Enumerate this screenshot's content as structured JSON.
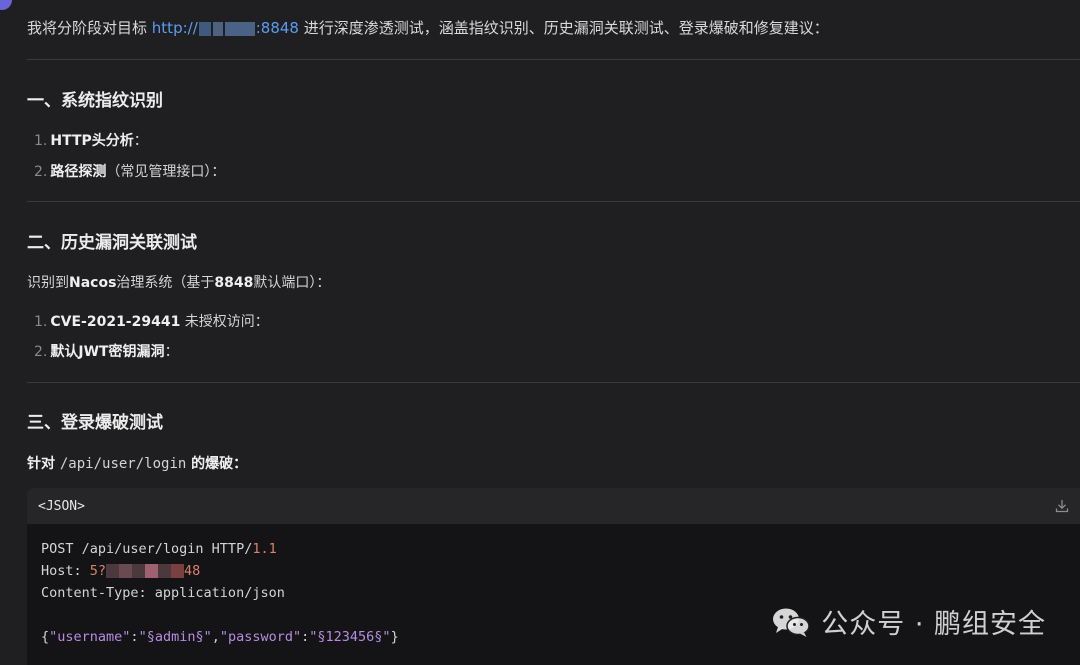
{
  "intro": {
    "prefix": "我将分阶段对目标",
    "link_start": "http://",
    "link_end": ":8848",
    "suffix": "进行深度渗透测试，涵盖指纹识别、历史漏洞关联测试、登录爆破和修复建议："
  },
  "section1": {
    "title": "一、系统指纹识别",
    "items": [
      {
        "num": "1.",
        "label": "HTTP头分析",
        "suffix": "："
      },
      {
        "num": "2.",
        "label": "路径探测",
        "suffix": "（常见管理接口）："
      }
    ]
  },
  "section2": {
    "title": "二、历史漏洞关联测试",
    "para_prefix": "识别到",
    "para_bold": "Nacos",
    "para_mid": "治理系统（基于",
    "para_bold2": "8848",
    "para_suffix": "默认端口）：",
    "items": [
      {
        "num": "1.",
        "label": "CVE-2021-29441",
        "suffix": " 未授权访问："
      },
      {
        "num": "2.",
        "label": "默认JWT密钥漏洞",
        "suffix": "："
      }
    ]
  },
  "section3": {
    "title": "三、登录爆破测试",
    "para_prefix": "针对 ",
    "para_code": "/api/user/login",
    "para_suffix": " 的爆破："
  },
  "code": {
    "lang": "<JSON>",
    "line1_a": "POST /api/user/login HTTP/",
    "line1_b": "1.1",
    "line2_a": "Host: ",
    "line2_b": "5?",
    "line2_c": "48",
    "line3": "Content-Type: application/json",
    "line5_a": "{",
    "line5_b": "\"username\"",
    "line5_c": ":",
    "line5_d": "\"§admin§\"",
    "line5_e": ",",
    "line5_f": "\"password\"",
    "line5_g": ":",
    "line5_h": "\"§123456§\"",
    "line5_i": "}"
  },
  "watermark": {
    "text": "公众号 · 鹏组安全",
    "icon": "wechat-icon"
  },
  "colors": {
    "background": "#1f1f21",
    "link": "#5b9cf2",
    "code_bg": "#141416",
    "number": "#d9826a",
    "string": "#b78ce0"
  }
}
